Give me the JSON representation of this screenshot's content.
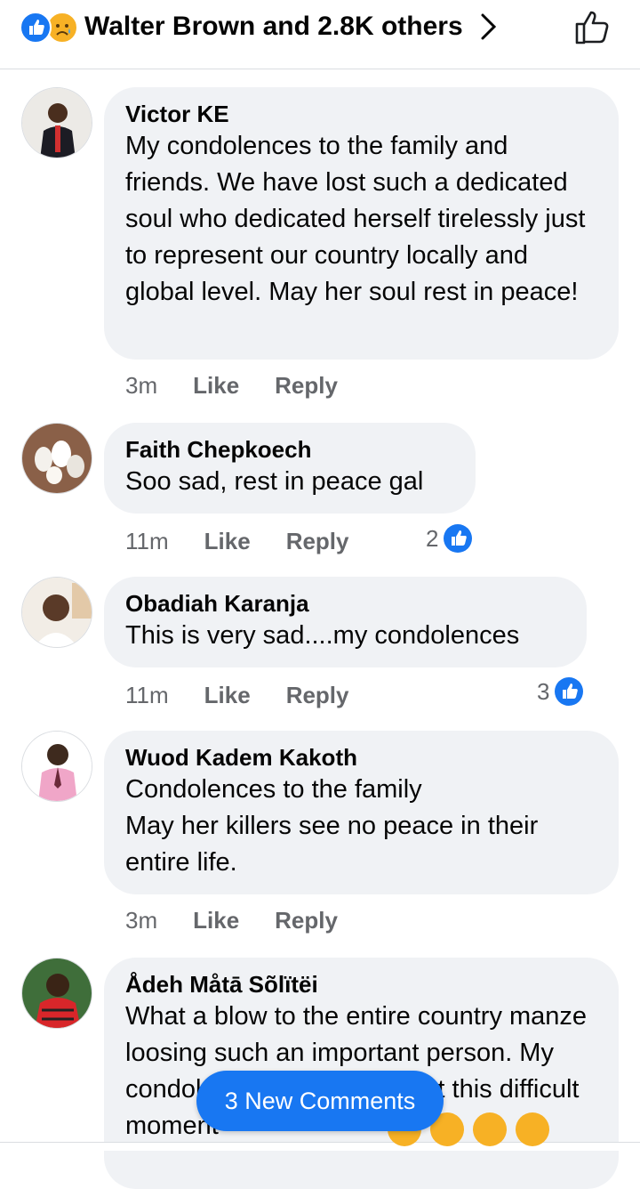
{
  "header": {
    "reactions_text": "Walter Brown and 2.8K others",
    "reaction_icons": [
      "like-icon",
      "sad-icon"
    ],
    "accent": "#1877f2"
  },
  "comments": [
    {
      "author": "Victor KE",
      "text": "My condolences to the family and friends. We have lost such a dedicated soul who dedicated herself tirelessly just to represent our country locally and global level. May her soul rest in peace!",
      "time": "3m",
      "like": "Like",
      "reply": "Reply",
      "reaction_count": ""
    },
    {
      "author": "Faith Chepkoech",
      "text": "Soo sad, rest in peace gal",
      "time": "11m",
      "like": "Like",
      "reply": "Reply",
      "reaction_count": "2"
    },
    {
      "author": "Obadiah Karanja",
      "text": "This is very sad....my condolences",
      "time": "11m",
      "like": "Like",
      "reply": "Reply",
      "reaction_count": "3"
    },
    {
      "author": "Wuod Kadem Kakoth",
      "text": "Condolences to the family\nMay her killers see no peace in their entire life.",
      "time": "3m",
      "like": "Like",
      "reply": "Reply",
      "reaction_count": ""
    },
    {
      "author": "Ådeh Måtā Sõlïtëi",
      "text": "What a blow to the entire country manze loosing such an  important person. My condolences to the family at this difficult moment",
      "time": "",
      "like": "",
      "reply": "",
      "reaction_count": ""
    }
  ],
  "new_comments_button": "3 New Comments",
  "colors": {
    "bubble": "#f0f2f5",
    "meta": "#65676b",
    "like_blue": "#1877f2",
    "sad_yellow": "#f7b125"
  }
}
